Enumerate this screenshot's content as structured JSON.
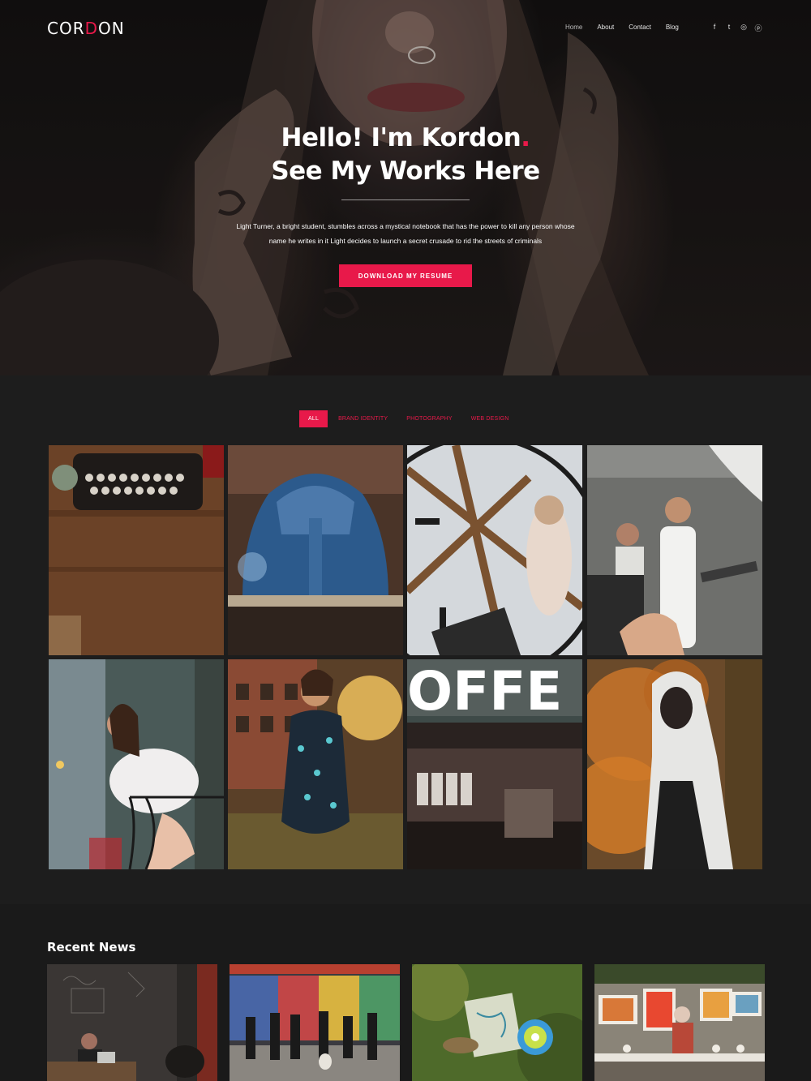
{
  "brand": {
    "logo_text_a": "COR",
    "logo_text_accent": "D",
    "logo_text_b": "ON",
    "accent_color": "#e8194a"
  },
  "nav": {
    "items": [
      {
        "label": "Home"
      },
      {
        "label": "About"
      },
      {
        "label": "Contact"
      },
      {
        "label": "Blog"
      }
    ],
    "social": [
      {
        "icon": "facebook-icon",
        "glyph": "f"
      },
      {
        "icon": "twitter-icon",
        "glyph": "t"
      },
      {
        "icon": "instagram-icon",
        "glyph": "◎"
      },
      {
        "icon": "pinterest-icon",
        "glyph": "ⓟ"
      }
    ]
  },
  "hero": {
    "title_line1": "Hello! I'm Kordon",
    "title_dot": ".",
    "title_line2": "See My Works Here",
    "description": "Light Turner, a bright student, stumbles across a mystical notebook that has the power to kill any person whose name he writes in it Light decides to launch a secret crusade to rid the streets of criminals",
    "button_label": "DOWNLOAD MY RESUME"
  },
  "portfolio": {
    "filters": [
      {
        "label": "ALL",
        "active": true
      },
      {
        "label": "BRAND IDENTITY",
        "active": false
      },
      {
        "label": "PHOTOGRAPHY",
        "active": false
      },
      {
        "label": "WEB DESIGN",
        "active": false
      }
    ],
    "tiles": [
      {
        "subject": "typewriter"
      },
      {
        "subject": "blue-car"
      },
      {
        "subject": "clock-woman"
      },
      {
        "subject": "photo-shoot"
      },
      {
        "subject": "balcony-woman"
      },
      {
        "subject": "sunset-woman"
      },
      {
        "subject": "coffee-shop",
        "sign_text": "OFFE"
      },
      {
        "subject": "smoke-hoodie"
      }
    ]
  },
  "news": {
    "title": "Recent News",
    "cards": [
      {
        "subject": "laptop-man"
      },
      {
        "subject": "graffiti-street"
      },
      {
        "subject": "map-cup"
      },
      {
        "subject": "painter-stall"
      }
    ]
  }
}
